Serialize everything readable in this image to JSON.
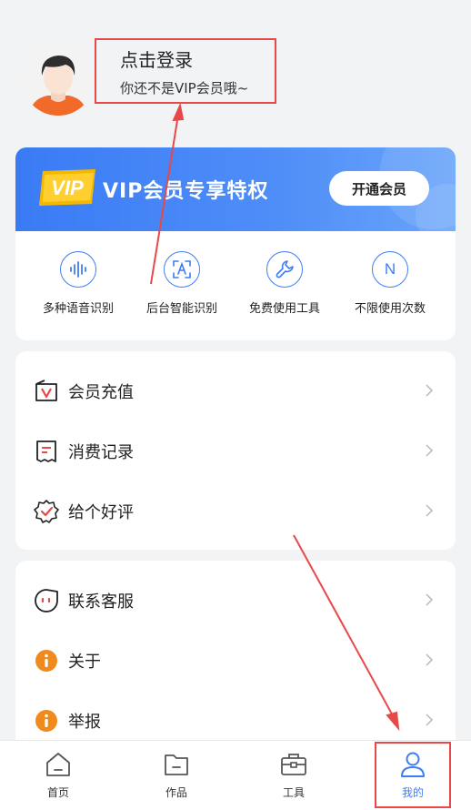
{
  "profile": {
    "login_title": "点击登录",
    "login_subtitle": "你还不是VIP会员哦~"
  },
  "vip": {
    "badge_text": "VIP",
    "title": "VIP会员专享特权",
    "open_button": "开通会员",
    "privileges": [
      {
        "label": "多种语音识别",
        "icon": "voice-wave-icon"
      },
      {
        "label": "后台智能识别",
        "icon": "text-recognition-icon"
      },
      {
        "label": "免费使用工具",
        "icon": "wrench-icon"
      },
      {
        "label": "不限使用次数",
        "icon": "unlimited-n-icon",
        "glyph": "N"
      }
    ]
  },
  "menu1": [
    {
      "label": "会员充值",
      "icon": "vip-recharge-icon"
    },
    {
      "label": "消费记录",
      "icon": "receipt-icon"
    },
    {
      "label": "给个好评",
      "icon": "rating-badge-icon"
    }
  ],
  "menu2": [
    {
      "label": "联系客服",
      "icon": "customer-service-icon"
    },
    {
      "label": "关于",
      "icon": "info-icon"
    },
    {
      "label": "举报",
      "icon": "report-icon"
    }
  ],
  "nav": {
    "items": [
      {
        "label": "首页",
        "icon": "home-icon"
      },
      {
        "label": "作品",
        "icon": "folder-icon"
      },
      {
        "label": "工具",
        "icon": "toolbox-icon"
      },
      {
        "label": "我的",
        "icon": "user-icon",
        "active": true
      }
    ]
  },
  "colors": {
    "accent": "#3f7df3",
    "annotation": "#e84848",
    "vip_gold": "#f5b800",
    "info_orange": "#f08a1c"
  }
}
